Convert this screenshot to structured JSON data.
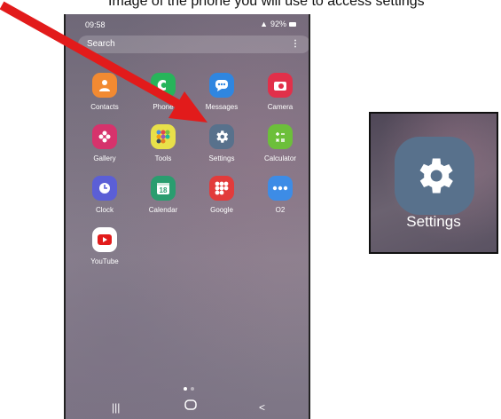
{
  "caption": {
    "text": "Image of the phone you will use to access settings"
  },
  "status": {
    "time": "09:58",
    "battery": "92%"
  },
  "search": {
    "placeholder": "Search"
  },
  "apps": [
    {
      "label": "Contacts",
      "icon": "contacts-icon",
      "color": "#f28a32"
    },
    {
      "label": "Phone",
      "icon": "phone-icon",
      "color": "#27b45a"
    },
    {
      "label": "Messages",
      "icon": "messages-icon",
      "color": "#2f86e0"
    },
    {
      "label": "Camera",
      "icon": "camera-icon",
      "color": "#e1304a"
    },
    {
      "label": "Gallery",
      "icon": "gallery-icon",
      "color": "#d6336c"
    },
    {
      "label": "Tools",
      "icon": "tools-folder-icon",
      "color": "#e8e04a"
    },
    {
      "label": "Settings",
      "icon": "gear-icon",
      "color": "#58718c"
    },
    {
      "label": "Calculator",
      "icon": "calculator-icon",
      "color": "#6cbf3a"
    },
    {
      "label": "Clock",
      "icon": "clock-icon",
      "color": "#5b5fd6"
    },
    {
      "label": "Calendar",
      "icon": "calendar-icon",
      "color": "#2a9d6f"
    },
    {
      "label": "Google",
      "icon": "google-folder-icon",
      "color": "#e23b3b"
    },
    {
      "label": "O2",
      "icon": "o2-folder-icon",
      "color": "#3d8ce6"
    },
    {
      "label": "YouTube",
      "icon": "youtube-icon",
      "color": "#ffffff"
    }
  ],
  "zoom": {
    "label": "Settings"
  },
  "colors": {
    "arrow": "#e21b1b",
    "settings": "#58718c"
  }
}
